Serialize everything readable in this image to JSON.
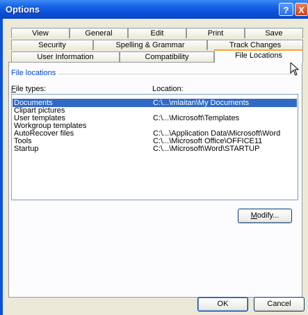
{
  "window": {
    "title": "Options",
    "help_glyph": "?",
    "close_glyph": "X"
  },
  "tabs_row1": [
    "View",
    "General",
    "Edit",
    "Print",
    "Save"
  ],
  "tabs_row2": [
    "Security",
    "Spelling & Grammar",
    "Track Changes"
  ],
  "tabs_row3": [
    "User Information",
    "Compatibility",
    "File Locations"
  ],
  "active_tab": "File Locations",
  "group": {
    "label": "File locations"
  },
  "columns": {
    "file_types_prefix": "F",
    "file_types_rest": "ile types:",
    "location": "Location:"
  },
  "rows": [
    {
      "type": "Documents",
      "location": "C:\\...\\mlaitan\\My Documents",
      "selected": true
    },
    {
      "type": "Clipart pictures",
      "location": ""
    },
    {
      "type": "User templates",
      "location": "C:\\...\\Microsoft\\Templates"
    },
    {
      "type": "Workgroup templates",
      "location": ""
    },
    {
      "type": "AutoRecover files",
      "location": "C:\\...\\Application Data\\Microsoft\\Word"
    },
    {
      "type": "Tools",
      "location": "C:\\...\\Microsoft Office\\OFFICE11"
    },
    {
      "type": "Startup",
      "location": "C:\\...\\Microsoft\\Word\\STARTUP"
    }
  ],
  "buttons": {
    "modify_prefix": "M",
    "modify_rest": "odify...",
    "ok": "OK",
    "cancel": "Cancel"
  },
  "colors": {
    "title_bar": "#0a52dd",
    "selection": "#316ac5",
    "tab_highlight": "#f7a531",
    "group_label": "#0046d5"
  }
}
